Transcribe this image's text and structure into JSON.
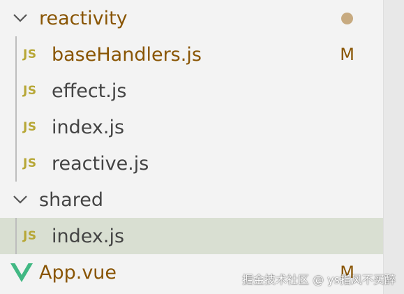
{
  "explorer": {
    "folders": [
      {
        "name": "reactivity",
        "state": "expanded",
        "status": "dot"
      },
      {
        "name": "shared",
        "state": "expanded"
      }
    ],
    "reactivity_files": [
      {
        "name": "baseHandlers.js",
        "icon": "JS",
        "status": "M",
        "modified": true
      },
      {
        "name": "effect.js",
        "icon": "JS"
      },
      {
        "name": "index.js",
        "icon": "JS"
      },
      {
        "name": "reactive.js",
        "icon": "JS"
      }
    ],
    "shared_files": [
      {
        "name": "index.js",
        "icon": "JS",
        "selected": true
      }
    ],
    "root_files": [
      {
        "name": "App.vue",
        "icon": "vue-icon",
        "status": "M",
        "modified": true
      }
    ]
  },
  "watermark": "掘金技术社区 @ ys指风不买醉",
  "colors": {
    "background": "#f3f3f3",
    "selected_row": "#d9dfd2",
    "modified_text": "#895503",
    "js_icon": "#b7a736",
    "vue_icon": "#41b883",
    "modified_dot": "#c7aa80"
  }
}
